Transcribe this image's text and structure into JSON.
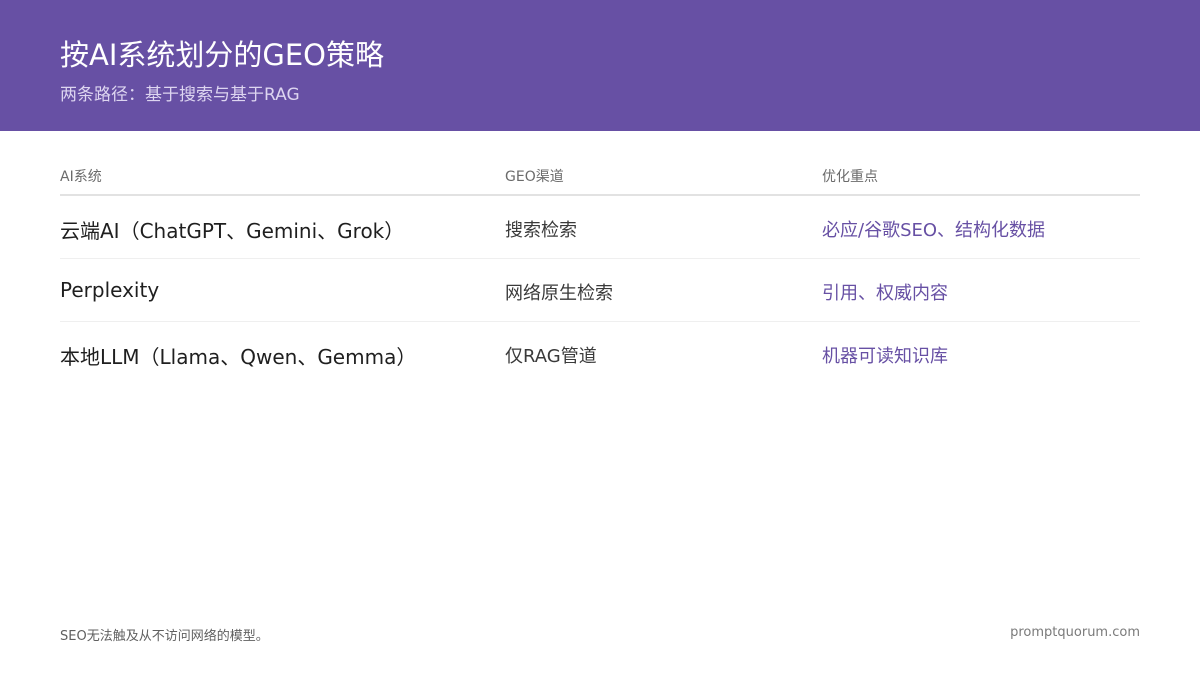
{
  "header": {
    "title": "按AI系统划分的GEO策略",
    "subtitle": "两条路径：基于搜索与基于RAG"
  },
  "table": {
    "columns": [
      "AI系统",
      "GEO渠道",
      "优化重点"
    ],
    "rows": [
      [
        "云端AI（ChatGPT、Gemini、Grok）",
        "搜索检索",
        "必应/谷歌SEO、结构化数据"
      ],
      [
        "Perplexity",
        "网络原生检索",
        "引用、权威内容"
      ],
      [
        "本地LLM（Llama、Qwen、Gemma）",
        "仅RAG管道",
        "机器可读知识库"
      ]
    ]
  },
  "footer": {
    "note": "SEO无法触及从不访问网络的模型。",
    "brand": "promptquorum.com"
  },
  "colors": {
    "header_bg": "#6750a4",
    "accent_text": "#6750a4"
  }
}
